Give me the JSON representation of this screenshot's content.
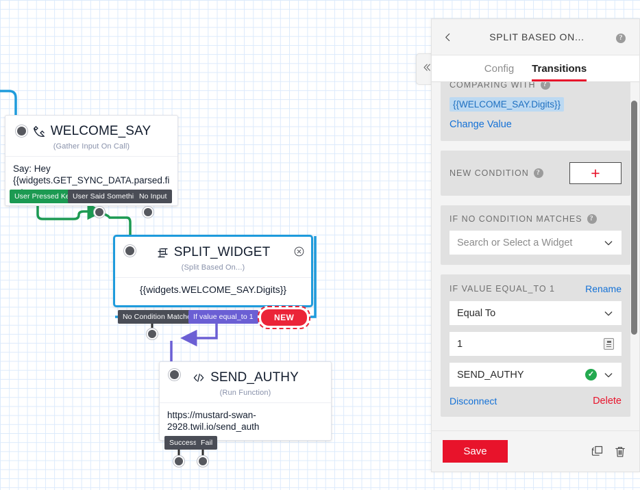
{
  "canvas": {
    "nodes": [
      {
        "id": "welcome_say",
        "title": "WELCOME_SAY",
        "subtitle": "(Gather Input On Call)",
        "icon": "phone-icon",
        "body": "Say: Hey {{widgets.GET_SYNC_DATA.parsed.first…",
        "outputs": [
          {
            "label": "User Pressed Keys",
            "color": "green"
          },
          {
            "label": "User Said Something",
            "color": "dark"
          },
          {
            "label": "No Input",
            "color": "dark"
          }
        ]
      },
      {
        "id": "split_widget",
        "title": "SPLIT_WIDGET",
        "subtitle": "(Split Based On...)",
        "icon": "split-icon",
        "body": "{{widgets.WELCOME_SAY.Digits}}",
        "selected": true,
        "close_icon": "close-circle-icon",
        "outputs": [
          {
            "label": "No Condition Matches",
            "color": "dark"
          },
          {
            "label": "If value equal_to 1",
            "color": "purple"
          },
          {
            "label": "NEW",
            "color": "new"
          }
        ]
      },
      {
        "id": "send_authy",
        "title": "SEND_AUTHY",
        "subtitle": "(Run Function)",
        "icon": "code-icon",
        "body": "https://mustard-swan-2928.twil.io/send_auth",
        "outputs": [
          {
            "label": "Success",
            "color": "dark"
          },
          {
            "label": "Fail",
            "color": "dark"
          }
        ]
      }
    ],
    "colors": {
      "edge_blue": "#1e9bdc",
      "edge_green": "#1c9a52",
      "edge_purple": "#6b5fd4",
      "edge_dark": "#2e2e2e",
      "grid": "#dceafb"
    }
  },
  "panel": {
    "back_icon": "chevron-left-icon",
    "title": "SPLIT BASED ON...",
    "help_icon": "help-icon",
    "collapse_icon": "double-chevron-left-icon",
    "tabs": [
      {
        "label": "Config",
        "active": false
      },
      {
        "label": "Transitions",
        "active": true
      }
    ],
    "sections": {
      "comparing_with": {
        "label": "COMPARING WITH",
        "token": "{{WELCOME_SAY.Digits}}",
        "change_value_label": "Change Value"
      },
      "new_condition": {
        "label": "NEW CONDITION",
        "add_label": "+"
      },
      "if_no_condition": {
        "label": "IF NO CONDITION MATCHES",
        "select_placeholder": "Search or Select a Widget",
        "chevron_icon": "chevron-down-icon"
      },
      "condition": {
        "label": "IF VALUE EQUAL_TO 1",
        "rename_label": "Rename",
        "operator_value": "Equal To",
        "value_value": "1",
        "value_type_icon": "number-input-icon",
        "target_value": "SEND_AUTHY",
        "target_status_icon": "check-circle-icon",
        "disconnect_label": "Disconnect",
        "delete_label": "Delete"
      }
    },
    "footer": {
      "save_label": "Save",
      "duplicate_icon": "duplicate-icon",
      "delete_icon": "trash-icon"
    },
    "accent": "#e8132b",
    "link_blue": "#1471d6"
  }
}
